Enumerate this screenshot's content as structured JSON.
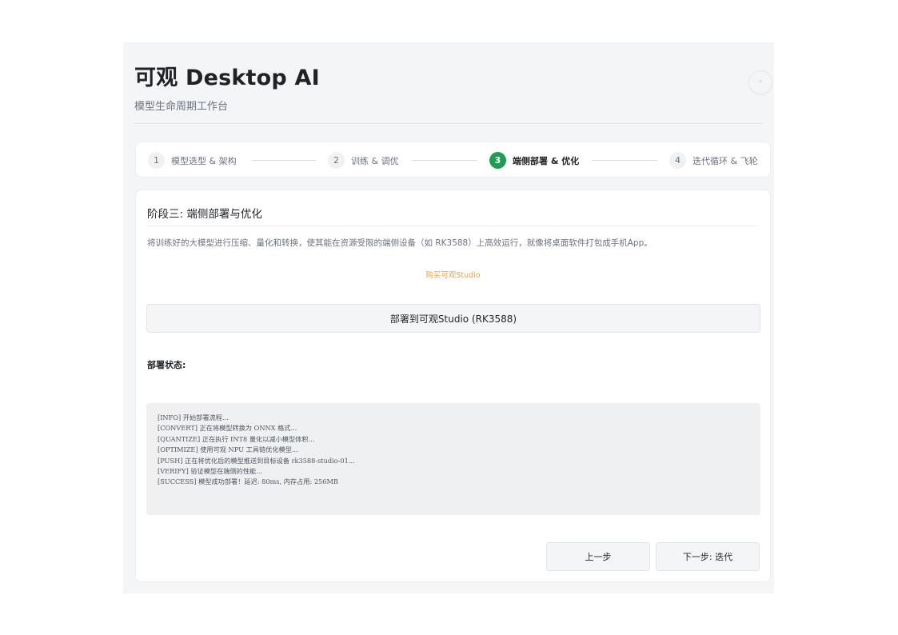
{
  "header": {
    "title": "可观 Desktop AI",
    "subtitle": "模型生命周期工作台",
    "theme_icon": "◦"
  },
  "stepper": {
    "steps": [
      {
        "num": "1",
        "label": "模型选型 & 架构",
        "active": false
      },
      {
        "num": "2",
        "label": "训练 & 调优",
        "active": false
      },
      {
        "num": "3",
        "label": "端侧部署 & 优化",
        "active": true
      },
      {
        "num": "4",
        "label": "迭代循环 & 飞轮",
        "active": false
      }
    ]
  },
  "stage": {
    "title": "阶段三: 端侧部署与优化",
    "description": "将训练好的大模型进行压缩、量化和转换，使其能在资源受限的端侧设备（如 RK3588）上高效运行，就像将桌面软件打包成手机App。",
    "buy_link": "购买可观Studio",
    "deploy_button": "部署到可观Studio (RK3588)",
    "status_label": "部署状态:",
    "log": [
      "[INFO] 开始部署流程...",
      "[CONVERT] 正在将模型转换为 ONNX 格式...",
      "[QUANTIZE] 正在执行 INT8 量化以减小模型体积...",
      "[OPTIMIZE] 使用可观 NPU 工具链优化模型...",
      "[PUSH] 正在将优化后的模型推送到目标设备 rk3588-studio-01...",
      "[VERIFY] 验证模型在端侧的性能...",
      "[SUCCESS] 模型成功部署！延迟: 80ms, 内存占用: 256MB"
    ]
  },
  "nav": {
    "prev": "上一步",
    "next": "下一步: 迭代"
  },
  "colors": {
    "accent_green": "#1f9d55",
    "link_orange": "#e8a33d"
  }
}
